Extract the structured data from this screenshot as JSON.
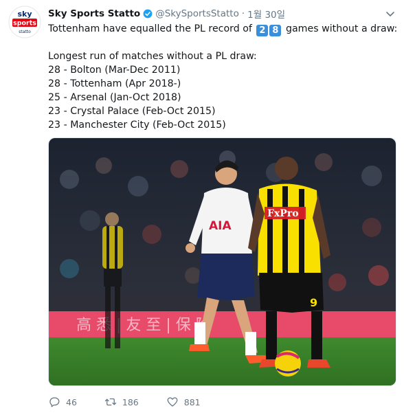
{
  "tweet": {
    "author": {
      "name": "Sky Sports Statto",
      "handle": "@SkySportsStatto"
    },
    "timestamp": "1월 30일",
    "avatar": {
      "line1": "sky",
      "line2": "sports",
      "line3": "statto"
    },
    "text": {
      "intro_before": "Tottenham have equalled the PL record of",
      "digit1": "2",
      "digit2": "8",
      "intro_after": "games without a draw:",
      "heading": "Longest run of matches without a PL draw:",
      "list": [
        "28 - Bolton (Mar-Dec 2011)",
        "28 - Tottenham (Apr 2018-)",
        "25 - Arsenal (Jan-Oct 2018)",
        "23 - Crystal Palace (Feb-Oct 2015)",
        "23 - Manchester City (Feb-Oct 2015)"
      ]
    },
    "photo": {
      "shirt_left": "AIA",
      "shirt_right": "FxPro",
      "number": "9",
      "board_text": "高 悉 | 友 至 | 保 险"
    },
    "actions": {
      "replies": "46",
      "retweets": "186",
      "likes": "881"
    },
    "colors": {
      "verified": "#1da1f2",
      "sky_red": "#e30613",
      "sky_blue": "#0a2a6e",
      "watford_yellow": "#f9e000"
    }
  }
}
